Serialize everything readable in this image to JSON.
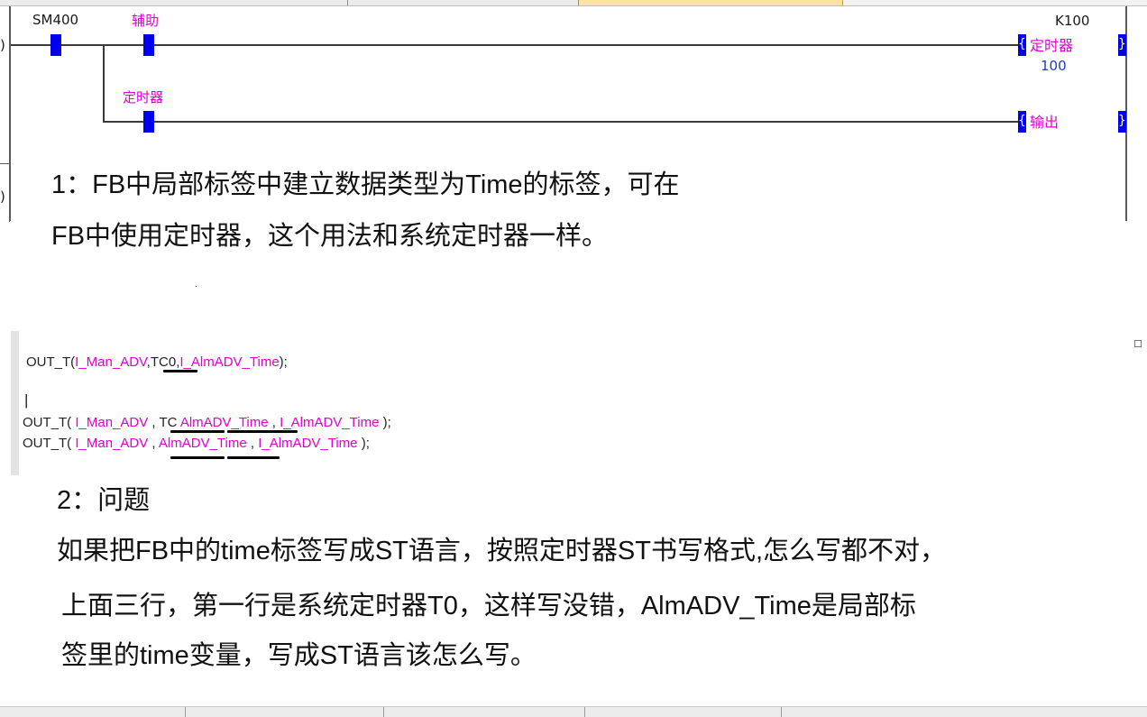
{
  "ladder": {
    "contact1_label": "SM400",
    "contact2_label": "辅助",
    "contact3_label": "定时器",
    "timer_const": "K100",
    "coil1_label": "定时器",
    "coil1_value": "100",
    "coil2_label": "输出",
    "coil_open": "{",
    "coil_close": "}",
    "left_mark_1": ")",
    "left_mark_2": ")"
  },
  "notes": {
    "line1": "1：FB中局部标签中建立数据类型为Time的标签，可在",
    "line2": "FB中使用定时器，这个用法和系统定时器一样。",
    "line3": "2：问题",
    "line4": "如果把FB中的time标签写成ST语言，按照定时器ST书写格式,怎么写都不对，",
    "line5": "上面三行，第一行是系统定时器T0，这样写没错，AlmADV_Time是局部标",
    "line6": "签里的time变量，写成ST语言该怎么写。",
    "stray_dot": "."
  },
  "code": {
    "l1_fn": "OUT_T(",
    "l1_a1": "I_Man_ADV",
    "l1_sep1": ",",
    "l1_a2": "TC0",
    "l1_sep2": ",",
    "l1_a3": "I_AlmADV_Time",
    "l1_end": ");",
    "cursor": "|",
    "l2_fn": "OUT_T(",
    "l2_a1": "I_Man_ADV",
    "l2_sep1": ",",
    "l2_tc": "TC",
    "l2_a2": "AlmADV_Time",
    "l2_sep2": ",",
    "l2_a3": "I_AlmADV_Time",
    "l2_end": ");",
    "l3_fn": "OUT_T(",
    "l3_a1": "I_Man_ADV",
    "l3_sep1": ",",
    "l3_a2": "AlmADV_Time",
    "l3_sep2": ",",
    "l3_a3": "I_AlmADV_Time",
    "l3_end": ");"
  },
  "colors": {
    "contact": "#0000ee",
    "label_pink": "#e000d0",
    "value_blue": "#1e3ccc"
  }
}
